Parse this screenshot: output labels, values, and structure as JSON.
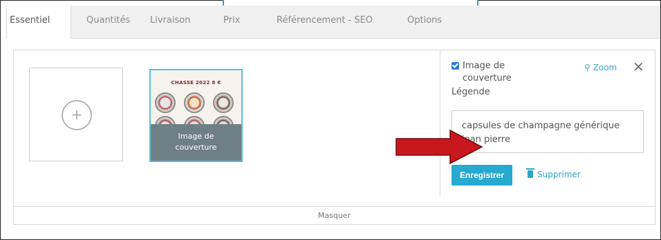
{
  "tabs": [
    {
      "label": "Essentiel",
      "active": true
    },
    {
      "label": "Quantités"
    },
    {
      "label": "Livraison"
    },
    {
      "label": "Prix"
    },
    {
      "label": "Référencement - SEO"
    },
    {
      "label": "Options"
    }
  ],
  "images": {
    "add_icon": "plus-icon",
    "thumbnail": {
      "title": "CHASSE 2022 8 €",
      "caption_line1": "Image de",
      "caption_line2": "couverture"
    }
  },
  "editor": {
    "cover_checkbox_checked": true,
    "cover_label": "Image de couverture",
    "zoom_label": "Zoom",
    "legend_label": "Légende",
    "legend_value": "capsules de champagne générique\njean pierre",
    "save_label": "Enregistrer",
    "delete_label": "Supprimer"
  },
  "footer": {
    "hide_label": "Masquer"
  },
  "colors": {
    "accent": "#27a9d0",
    "checkbox": "#2d7bd6",
    "annotation_arrow": "#c8171d",
    "caption_overlay": "#6f7f86"
  }
}
